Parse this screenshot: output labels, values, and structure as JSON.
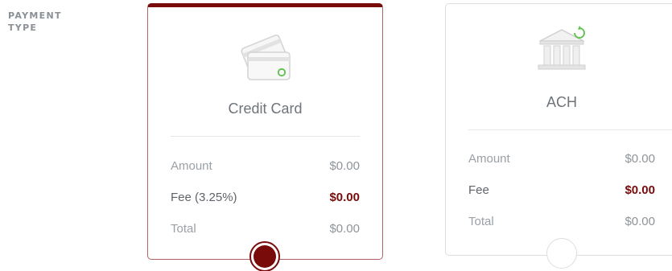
{
  "section_label": "PAYMENT TYPE",
  "colors": {
    "accent": "#7a0b0b",
    "muted_text": "#9aa0a6",
    "icon_gray": "#d8d8d8",
    "icon_green": "#5cc24a"
  },
  "cards": [
    {
      "title": "Credit Card",
      "icon": "credit-card-icon",
      "selected": true,
      "rows": [
        {
          "label": "Amount",
          "value": "$0.00"
        },
        {
          "label": "Fee (3.25%)",
          "value": "$0.00"
        },
        {
          "label": "Total",
          "value": "$0.00"
        }
      ]
    },
    {
      "title": "ACH",
      "icon": "bank-icon",
      "selected": false,
      "rows": [
        {
          "label": "Amount",
          "value": "$0.00"
        },
        {
          "label": "Fee",
          "value": "$0.00"
        },
        {
          "label": "Total",
          "value": "$0.00"
        }
      ]
    }
  ]
}
